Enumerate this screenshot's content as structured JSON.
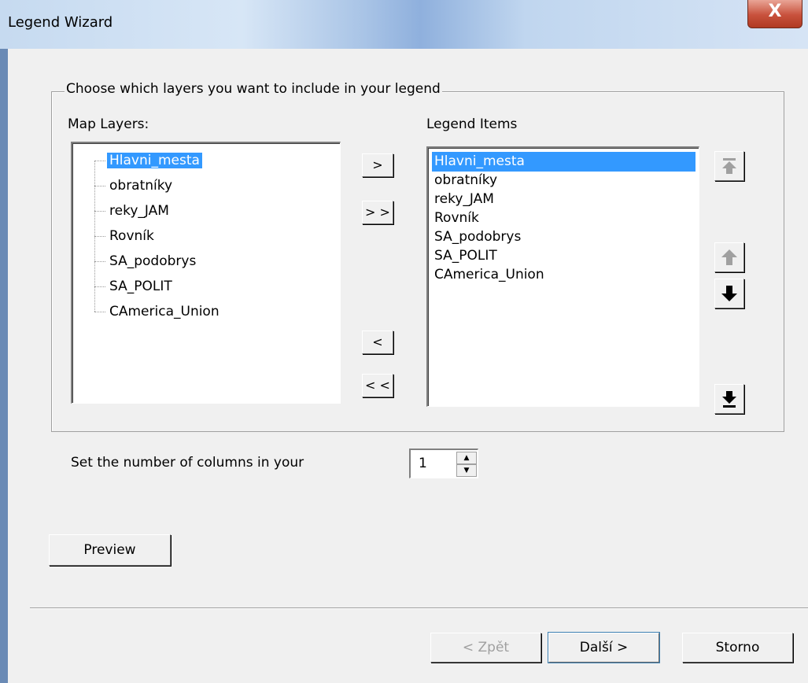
{
  "window": {
    "title": "Legend Wizard",
    "close_label": "X"
  },
  "group": {
    "caption": "Choose which layers you want to include in your legend"
  },
  "map_layers": {
    "label": "Map Layers:",
    "items": [
      "Hlavni_mesta",
      "obratníky",
      "reky_JAM",
      "Rovník",
      "SA_podobrys",
      "SA_POLIT",
      "CAmerica_Union"
    ],
    "selected": "Hlavni_mesta"
  },
  "legend_items": {
    "label": "Legend Items",
    "items": [
      "Hlavni_mesta",
      "obratníky",
      "reky_JAM",
      "Rovník",
      "SA_podobrys",
      "SA_POLIT",
      "CAmerica_Union"
    ],
    "selected": "Hlavni_mesta"
  },
  "transfer_buttons": {
    "add": ">",
    "add_all": "> >",
    "remove": "<",
    "remove_all": "< <"
  },
  "order_buttons": {
    "top_icon": "move-to-top-icon",
    "up_icon": "move-up-icon",
    "down_icon": "move-down-icon",
    "bottom_icon": "move-to-bottom-icon"
  },
  "columns": {
    "label": "Set the number of columns in your",
    "value": "1"
  },
  "preview_label": "Preview",
  "footer": {
    "back_label": "< Zpět",
    "next_label": "Další >",
    "cancel_label": "Storno"
  }
}
